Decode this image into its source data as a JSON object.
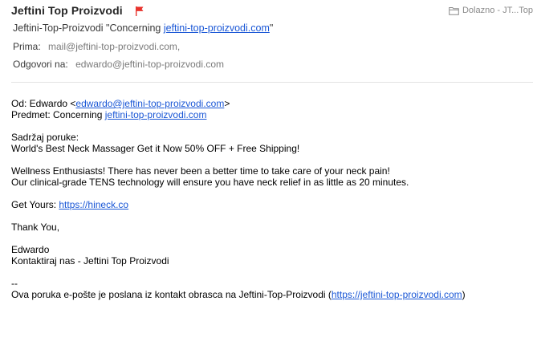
{
  "header": {
    "sender_name": "Jeftini Top Proizvodi",
    "flag_color": "#e8322b",
    "mailbox_label": "Dolazno - JT...Top",
    "subject_prefix": "Jeftini-Top-Proizvodi \"Concerning ",
    "subject_link": "jeftini-top-proizvodi.com",
    "subject_suffix": "\"",
    "to_label": "Prima:",
    "to_value": "mail@jeftini-top-proizvodi.com,",
    "reply_label": "Odgovori na:",
    "reply_value": "edwardo@jeftini-top-proizvodi.com"
  },
  "body": {
    "from_prefix": "Od: Edwardo <",
    "from_email": "edwardo@jeftini-top-proizvodi.com",
    "from_suffix": ">",
    "subject_prefix": "Predmet: Concerning ",
    "subject_link": "jeftini-top-proizvodi.com",
    "content_label": "Sadržaj poruke:",
    "headline": "World's Best Neck Massager Get it Now 50% OFF + Free Shipping!",
    "para1_line1": "Wellness Enthusiasts! There has never been a better time to take care of your neck pain!",
    "para1_line2": "Our clinical-grade TENS technology will ensure you have neck relief in as little as 20 minutes.",
    "get_yours_prefix": "Get Yours: ",
    "get_yours_link": "https://hineck.co",
    "thanks": "Thank You,",
    "signature_name": "Edwardo",
    "signature_contact": "Kontaktiraj nas - Jeftini Top Proizvodi",
    "separator": "--",
    "footer_prefix": "Ova poruka e-pošte je poslana iz kontakt obrasca na Jeftini-Top-Proizvodi (",
    "footer_link": "https://jeftini-top-proizvodi.com",
    "footer_suffix": ")"
  },
  "icons": {
    "flag": "flag-icon",
    "folder": "folder-icon"
  }
}
